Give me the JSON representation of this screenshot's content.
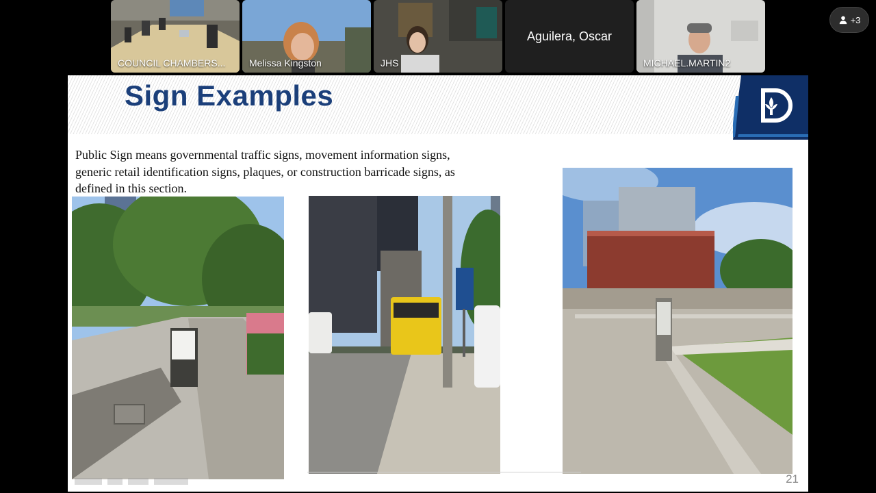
{
  "participants": [
    {
      "name": "COUNCIL CHAMBERS..."
    },
    {
      "name": "Melissa Kingston"
    },
    {
      "name": "JHS"
    },
    {
      "name": "Aguilera, Oscar"
    },
    {
      "name": "MICHAEL.MARTIN2"
    }
  ],
  "overflow": {
    "label": "+3",
    "icon": "person-icon"
  },
  "slide": {
    "title": "Sign Examples",
    "body": "Public Sign means governmental traffic signs, movement information signs, generic retail identification signs, plaques, or construction barricade signs, as defined in this section.",
    "page_number": "21",
    "logo": "city-of-dallas-logo"
  },
  "colors": {
    "title_blue": "#1b3f7a",
    "logo_navy": "#0f2f66",
    "logo_blue": "#2a6db5"
  }
}
